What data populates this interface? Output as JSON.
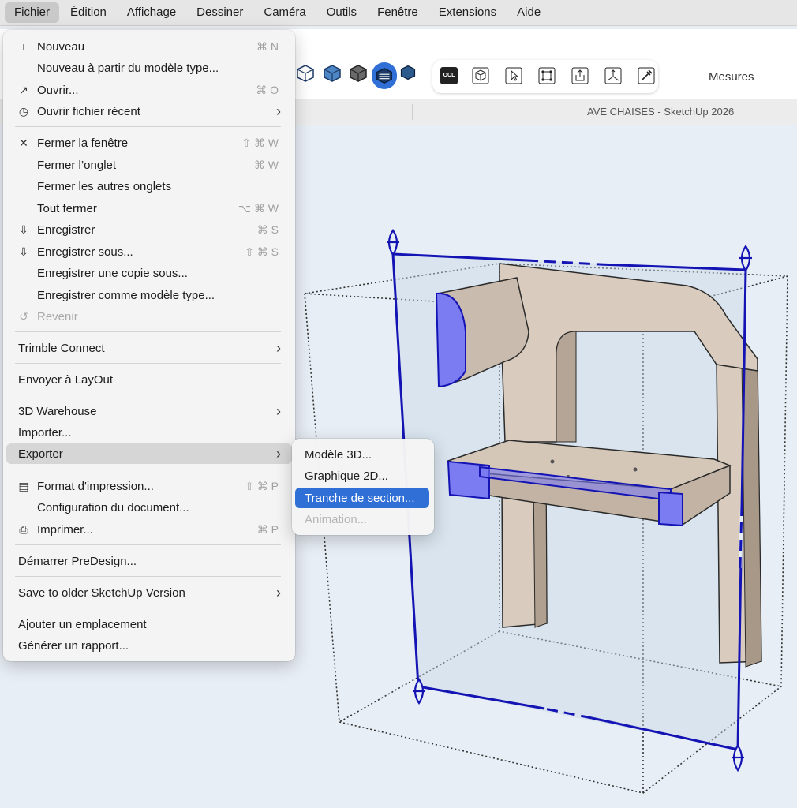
{
  "menubar": {
    "items": [
      "Fichier",
      "Édition",
      "Affichage",
      "Dessiner",
      "Caméra",
      "Outils",
      "Fenêtre",
      "Extensions",
      "Aide"
    ]
  },
  "toolbar": {
    "measurements_label": "Mesures",
    "ocl_label": "OCL"
  },
  "window": {
    "title": "AVE CHAISES - SketchUp 2026"
  },
  "file_menu": {
    "items": [
      {
        "icon": "plus-icon",
        "label": "Nouveau",
        "shortcut": "⌘ N"
      },
      {
        "label": "Nouveau à partir du modèle type..."
      },
      {
        "icon": "open-arrow-icon",
        "label": "Ouvrir...",
        "shortcut": "⌘ O"
      },
      {
        "icon": "recent-clock-icon",
        "label": "Ouvrir fichier récent",
        "submenu": true
      },
      {
        "icon": "close-x-icon",
        "label": "Fermer la fenêtre",
        "shortcut": "⇧ ⌘ W"
      },
      {
        "label": "Fermer l’onglet",
        "shortcut": "⌘ W"
      },
      {
        "label": "Fermer les autres onglets"
      },
      {
        "label": "Tout fermer",
        "shortcut": "⌥ ⌘ W"
      },
      {
        "icon": "save-icon",
        "label": "Enregistrer",
        "shortcut": "⌘ S"
      },
      {
        "icon": "save-as-icon",
        "label": "Enregistrer sous...",
        "shortcut": "⇧ ⌘ S"
      },
      {
        "label": "Enregistrer une copie sous..."
      },
      {
        "label": "Enregistrer comme modèle type..."
      },
      {
        "icon": "revert-icon",
        "label": "Revenir",
        "disabled": true
      },
      {
        "label": "Trimble Connect",
        "submenu": true
      },
      {
        "label": "Envoyer à LayOut"
      },
      {
        "label": "3D Warehouse",
        "submenu": true
      },
      {
        "label": "Importer..."
      },
      {
        "label": "Exporter",
        "submenu": true,
        "highlighted": true
      },
      {
        "icon": "page-setup-icon",
        "label": "Format d'impression...",
        "shortcut": "⇧ ⌘ P"
      },
      {
        "label": "Configuration du document..."
      },
      {
        "icon": "printer-icon",
        "label": "Imprimer...",
        "shortcut": "⌘ P"
      },
      {
        "label": "Démarrer PreDesign..."
      },
      {
        "label": "Save to older SketchUp Version",
        "submenu": true
      },
      {
        "label": "Ajouter un emplacement"
      },
      {
        "label": "Générer un rapport..."
      }
    ]
  },
  "export_submenu": {
    "items": [
      {
        "label": "Modèle 3D..."
      },
      {
        "label": "Graphique 2D..."
      },
      {
        "label": "Tranche de section...",
        "selected": true
      },
      {
        "label": "Animation...",
        "disabled": true
      }
    ]
  },
  "colors": {
    "selection_blue": "#2f6fd6",
    "section_plane_blue": "#1414b4",
    "section_fill": "#7b7bf2",
    "wood": "#d9ccbe"
  }
}
